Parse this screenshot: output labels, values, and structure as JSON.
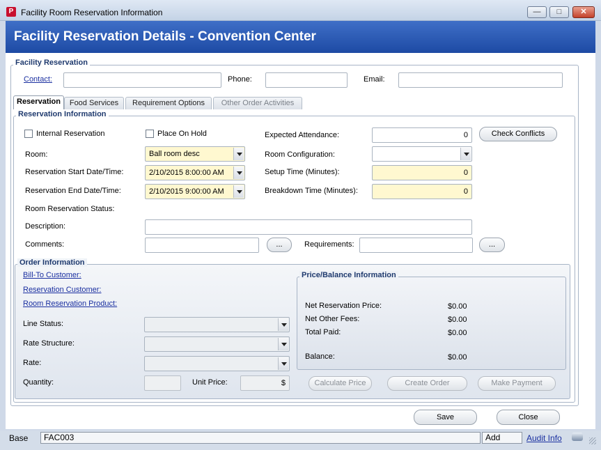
{
  "window": {
    "title": "Facility Room Reservation Information",
    "app_icon": "P"
  },
  "banner": {
    "title": "Facility Reservation Details - Convention Center"
  },
  "facility_reservation": {
    "legend": "Facility Reservation",
    "contact_label": "Contact:",
    "phone_label": "Phone:",
    "email_label": "Email:",
    "contact_value": "",
    "phone_value": "",
    "email_value": ""
  },
  "tabs": [
    {
      "label": "Reservation"
    },
    {
      "label": "Food Services"
    },
    {
      "label": "Requirement Options"
    },
    {
      "label": "Other Order Activities"
    }
  ],
  "reservation_info": {
    "legend": "Reservation Information",
    "internal_reservation": "Internal Reservation",
    "place_on_hold": "Place On Hold",
    "expected_attendance_label": "Expected Attendance:",
    "expected_attendance_value": "0",
    "check_conflicts": "Check Conflicts",
    "room_label": "Room:",
    "room_value": "Ball room desc",
    "room_config_label": "Room Configuration:",
    "room_config_value": "",
    "start_label": "Reservation Start Date/Time:",
    "start_value": "2/10/2015 8:00:00 AM",
    "setup_label": "Setup Time (Minutes):",
    "setup_value": "0",
    "end_label": "Reservation End Date/Time:",
    "end_value": "2/10/2015 9:00:00 AM",
    "breakdown_label": "Breakdown Time (Minutes):",
    "breakdown_value": "0",
    "status_label": "Room Reservation Status:",
    "description_label": "Description:",
    "description_value": "",
    "comments_label": "Comments:",
    "comments_value": "",
    "requirements_label": "Requirements:",
    "requirements_value": "",
    "ellipsis": "..."
  },
  "order_info": {
    "legend": "Order Information",
    "bill_to": "Bill-To Customer:",
    "reservation_customer": "Reservation Customer:",
    "room_product": "Room Reservation Product:",
    "line_status_label": "Line Status:",
    "rate_structure_label": "Rate Structure:",
    "rate_label": "Rate:",
    "quantity_label": "Quantity:",
    "quantity_value": "",
    "unit_price_label": "Unit Price:",
    "unit_price_value": "$",
    "calculate_price": "Calculate Price",
    "create_order": "Create Order",
    "make_payment": "Make Payment"
  },
  "price_balance": {
    "legend": "Price/Balance Information",
    "net_reservation_label": "Net Reservation Price:",
    "net_reservation_value": "$0.00",
    "net_other_label": "Net Other Fees:",
    "net_other_value": "$0.00",
    "total_paid_label": "Total Paid:",
    "total_paid_value": "$0.00",
    "balance_label": "Balance:",
    "balance_value": "$0.00"
  },
  "footer": {
    "save": "Save",
    "close": "Close"
  },
  "statusbar": {
    "base": "Base",
    "code": "FAC003",
    "mode": "Add",
    "audit": "Audit Info"
  },
  "colors": {
    "banner": "#1d4aa4",
    "required_field": "#fff8d0",
    "link": "#1a2fa0"
  }
}
